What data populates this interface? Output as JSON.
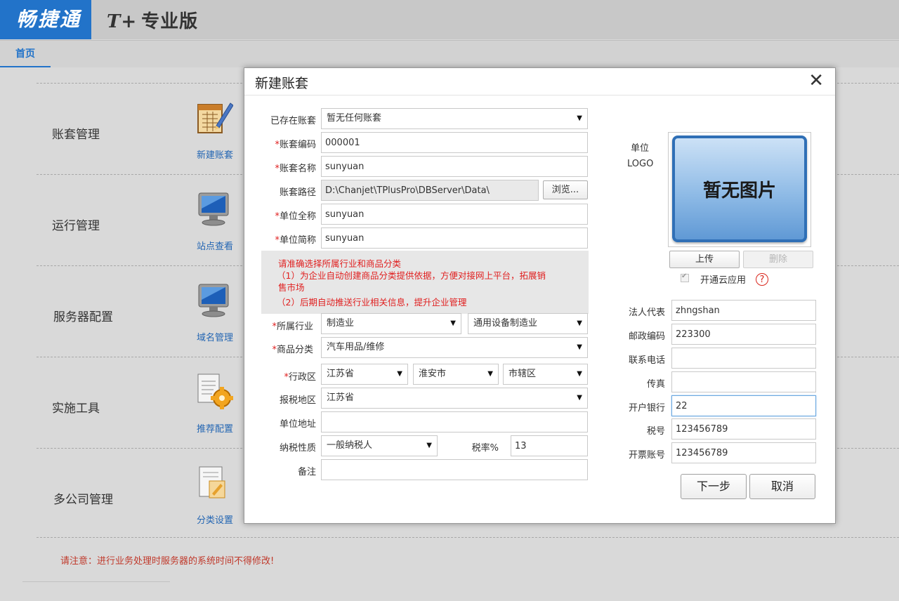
{
  "header": {
    "brand": "畅捷通",
    "edition_prefix": "T+",
    "edition": "专业版",
    "home_tab": "首页"
  },
  "modules": [
    {
      "title": "账套管理",
      "icon": "ledger-book-pencil-icon",
      "link": "新建账套"
    },
    {
      "title": "运行管理",
      "icon": "monitor-icon",
      "link": "站点查看"
    },
    {
      "title": "服务器配置",
      "icon": "monitor-icon",
      "link": "域名管理"
    },
    {
      "title": "实施工具",
      "icon": "document-gear-icon",
      "link": "推荐配置"
    },
    {
      "title": "多公司管理",
      "icon": "document-edit-icon",
      "link": "分类设置"
    }
  ],
  "notice": "请注意：进行业务处理时服务器的系统时间不得修改!",
  "dialog": {
    "title": "新建账套",
    "close": "✕",
    "existing_label": "已存在账套",
    "existing_value": "暂无任何账套",
    "code_label": "账套编码",
    "code_value": "000001",
    "name_label": "账套名称",
    "name_value": "sunyuan",
    "path_label": "账套路径",
    "path_value": "D:\\Chanjet\\TPlusPro\\DBServer\\Data\\",
    "browse": "浏览...",
    "fullname_label": "单位全称",
    "fullname_value": "sunyuan",
    "shortname_label": "单位简称",
    "shortname_value": "sunyuan",
    "hint_lines": [
      "请准确选择所属行业和商品分类",
      "（1）为企业自动创建商品分类提供依据，方便对接网上平台，拓展销",
      "售市场",
      "（2）后期自动推送行业相关信息，提升企业管理"
    ],
    "industry_label": "所属行业",
    "industry_value": "制造业",
    "industry_sub_value": "通用设备制造业",
    "category_label": "商品分类",
    "category_value": "汽车用品/维修",
    "region_label": "行政区",
    "province": "江苏省",
    "city": "淮安市",
    "district": "市辖区",
    "tax_region_label": "报税地区",
    "tax_region_value": "江苏省",
    "address_label": "单位地址",
    "address_value": "",
    "tax_type_label": "纳税性质",
    "tax_type_value": "一般纳税人",
    "tax_rate_label": "税率%",
    "tax_rate_value": "13",
    "remark_label": "备注",
    "remark_value": "",
    "logo_label_1": "单位",
    "logo_label_2": "LOGO",
    "logo_placeholder": "暂无图片",
    "upload": "上传",
    "delete": "删除",
    "cloud_label": "开通云应用",
    "help": "?",
    "legal_label": "法人代表",
    "legal_value": "zhngshan",
    "zip_label": "邮政编码",
    "zip_value": "223300",
    "phone_label": "联系电话",
    "phone_value": "",
    "fax_label": "传真",
    "fax_value": "",
    "bank_label": "开户银行",
    "bank_value": "22",
    "taxno_label": "税号",
    "taxno_value": "123456789",
    "invoice_label": "开票账号",
    "invoice_value": "123456789",
    "next": "下一步",
    "cancel": "取消",
    "arrow": "▼",
    "required_mark": "*"
  },
  "colors": {
    "brand_blue": "#2273c9",
    "required_red": "#e02020",
    "link_blue": "#2466b3"
  }
}
